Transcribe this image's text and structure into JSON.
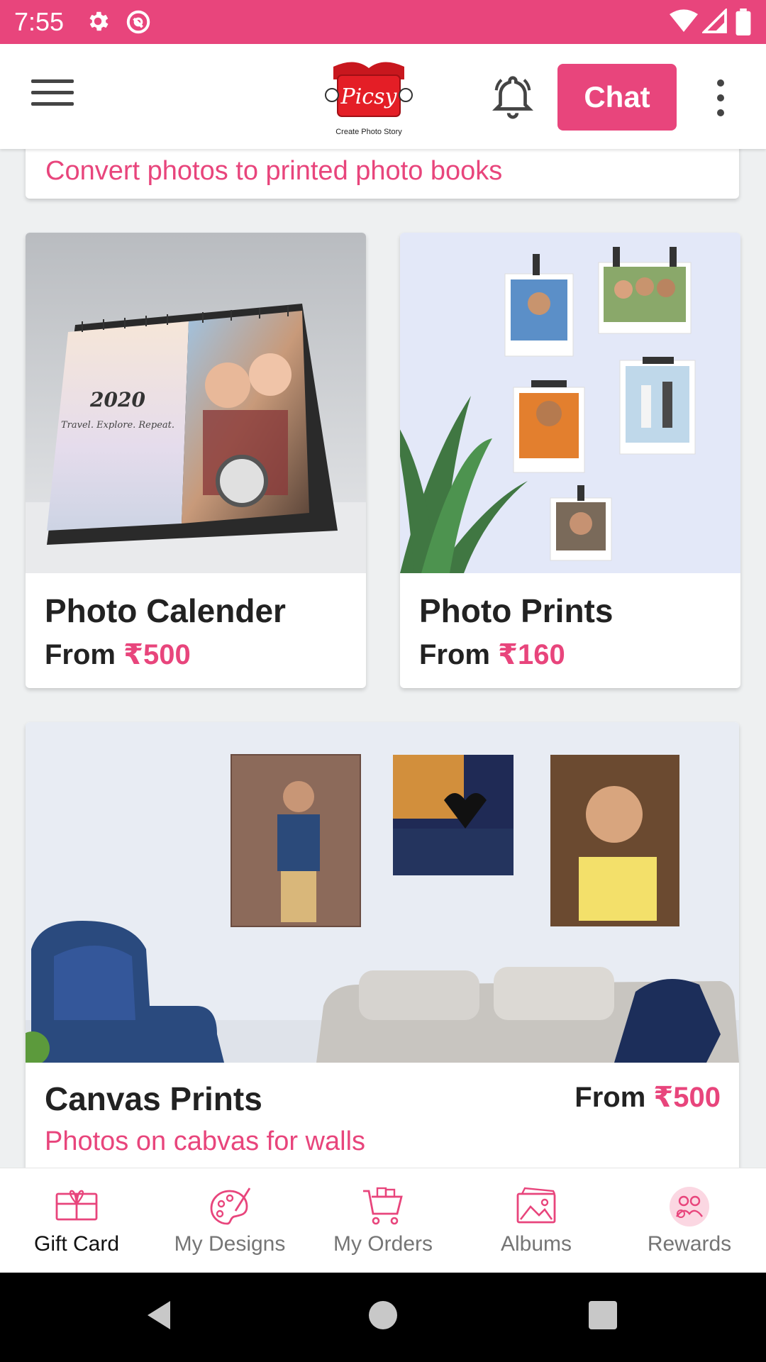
{
  "status_bar": {
    "time": "7:55"
  },
  "app_bar": {
    "logo_text": "Picsy",
    "logo_tagline": "Create Photo Story",
    "chat_label": "Chat"
  },
  "previous_card": {
    "subtitle": "Convert photos to printed photo books"
  },
  "products": {
    "calendar": {
      "title": "Photo Calender",
      "price_prefix": "From",
      "price": "₹500",
      "image_text_year": "2020",
      "image_text_tagline": "Travel. Explore. Repeat."
    },
    "prints": {
      "title": "Photo Prints",
      "price_prefix": "From",
      "price": "₹160"
    },
    "canvas": {
      "title": "Canvas Prints",
      "price_prefix": "From",
      "price": "₹500",
      "subtitle": "Photos on cabvas for walls"
    }
  },
  "bottom_nav": [
    {
      "label": "Gift Card",
      "icon": "gift-card-icon",
      "active": true
    },
    {
      "label": "My Designs",
      "icon": "palette-icon",
      "active": false
    },
    {
      "label": "My Orders",
      "icon": "cart-icon",
      "active": false
    },
    {
      "label": "Albums",
      "icon": "albums-icon",
      "active": false
    },
    {
      "label": "Rewards",
      "icon": "rewards-icon",
      "active": false
    }
  ],
  "colors": {
    "accent": "#e8457c",
    "status_bar": "#e8457c",
    "text_dark": "#222222"
  }
}
